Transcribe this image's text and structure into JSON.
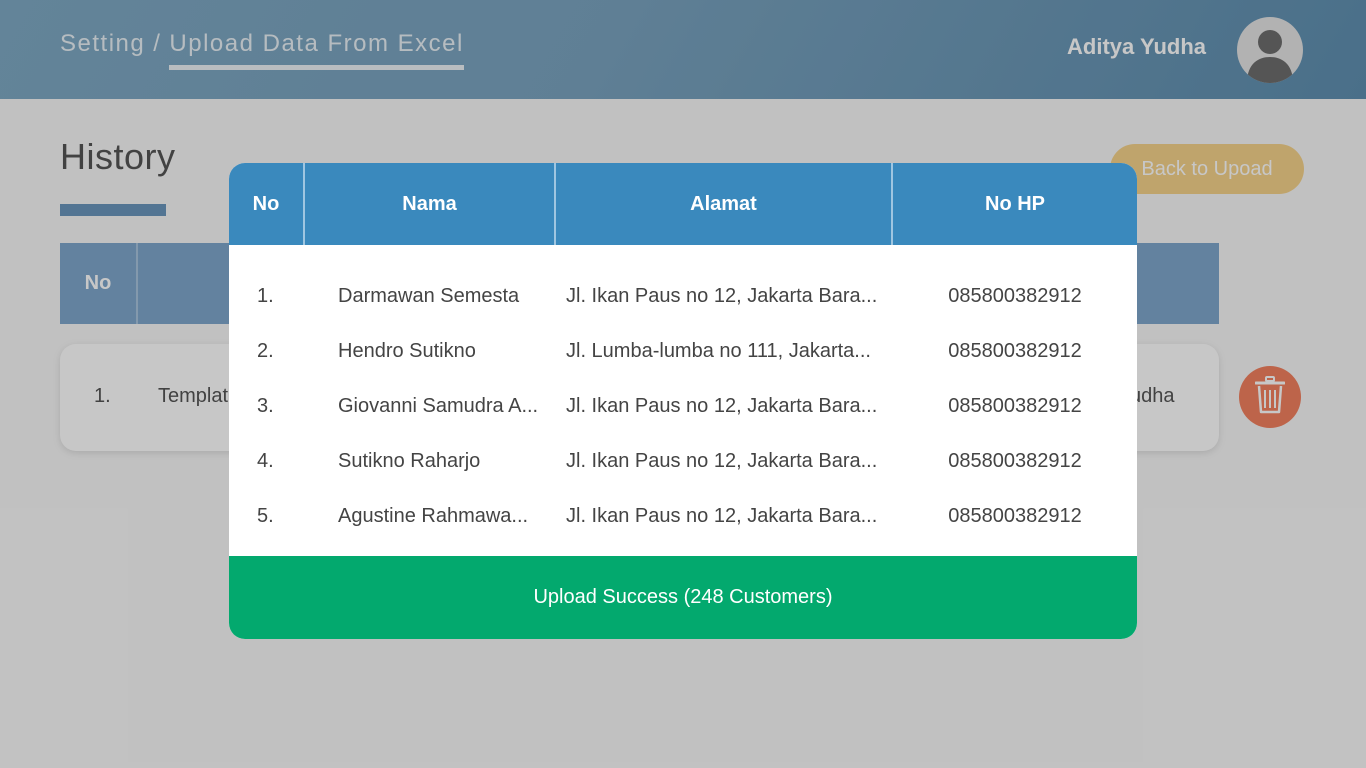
{
  "header": {
    "breadcrumb_root": "Setting",
    "breadcrumb_separator": "/",
    "breadcrumb_current": "Upload Data From Excel",
    "user_name": "Aditya Yudha"
  },
  "page": {
    "title": "History",
    "back_button": "Back to Upoad",
    "history_table": {
      "headers": {
        "no": "No"
      },
      "rows": [
        {
          "no": "1.",
          "file": "Templat",
          "user": "udha"
        }
      ]
    }
  },
  "modal": {
    "headers": {
      "no": "No",
      "nama": "Nama",
      "alamat": "Alamat",
      "hp": "No HP"
    },
    "rows": [
      {
        "no": "1.",
        "nama": "Darmawan Semesta",
        "alamat": "Jl. Ikan Paus no 12, Jakarta Bara...",
        "hp": "085800382912"
      },
      {
        "no": "2.",
        "nama": "Hendro Sutikno",
        "alamat": "Jl. Lumba-lumba no 111, Jakarta...",
        "hp": "085800382912"
      },
      {
        "no": "3.",
        "nama": "Giovanni Samudra A...",
        "alamat": "Jl. Ikan Paus no 12, Jakarta Bara...",
        "hp": "085800382912"
      },
      {
        "no": "4.",
        "nama": "Sutikno Raharjo",
        "alamat": "Jl. Ikan Paus no 12, Jakarta Bara...",
        "hp": "085800382912"
      },
      {
        "no": "5.",
        "nama": "Agustine Rahmawa...",
        "alamat": "Jl. Ikan Paus no 12, Jakarta Bara...",
        "hp": "085800382912"
      }
    ],
    "status": "Upload Success (248 Customers)"
  },
  "icons": {
    "avatar": "user-avatar-icon",
    "delete": "trash-icon"
  },
  "colors": {
    "header_gradient": [
      "#7fa9c4",
      "#5f8fb0"
    ],
    "modal_header": "#3a89bd",
    "success": "#03a96e",
    "back_button": "#f5d28b",
    "delete_button": "#f3805f"
  }
}
